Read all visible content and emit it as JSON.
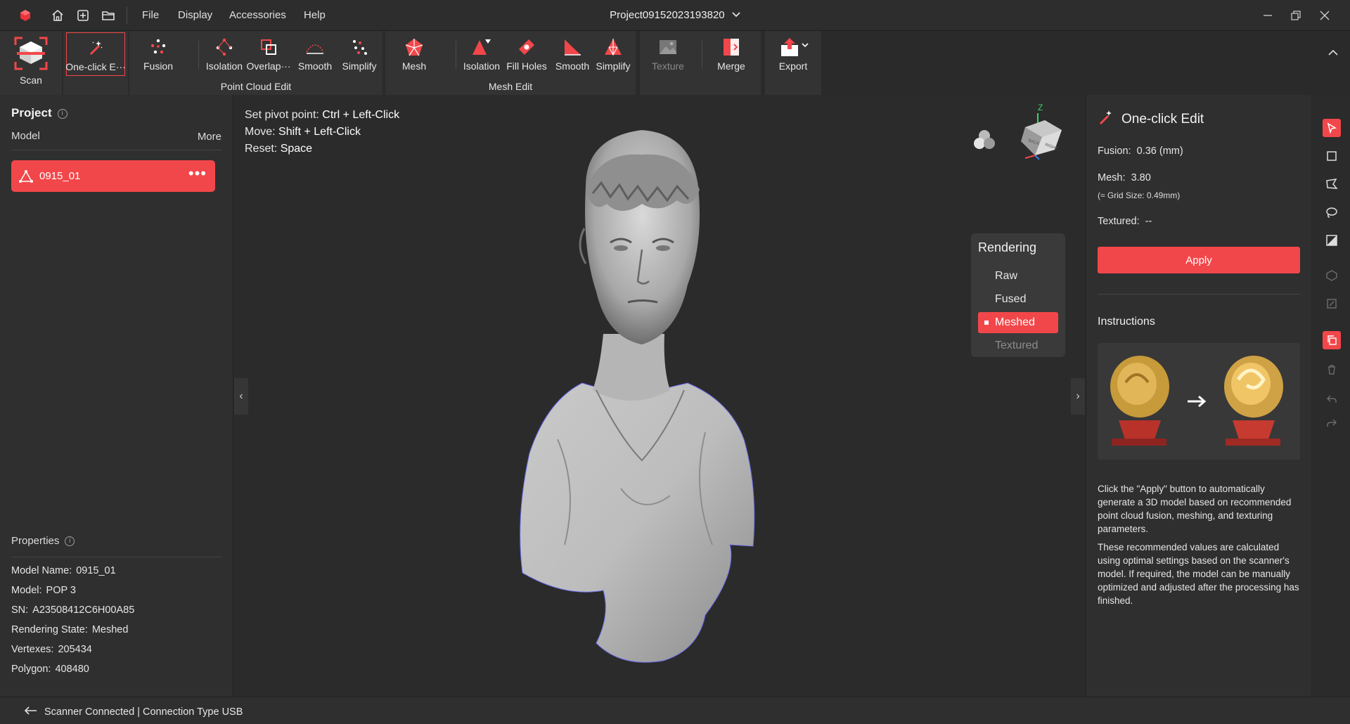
{
  "titlebar": {
    "menus": [
      "File",
      "Display",
      "Accessories",
      "Help"
    ],
    "project_title": "Project09152023193820"
  },
  "ribbon": {
    "scan_label": "Scan",
    "one_click_label": "One-click E···",
    "fusion_label": "Fusion",
    "pc_isolation_label": "Isolation",
    "pc_overlap_label": "Overlap···",
    "pc_smooth_label": "Smooth",
    "pc_simplify_label": "Simplify",
    "point_cloud_group": "Point Cloud Edit",
    "mesh_label": "Mesh",
    "mesh_isolation_label": "Isolation",
    "fill_holes_label": "Fill Holes",
    "mesh_smooth_label": "Smooth",
    "mesh_simplify_label": "Simplify",
    "mesh_group": "Mesh Edit",
    "texture_label": "Texture",
    "merge_label": "Merge",
    "export_label": "Export"
  },
  "left": {
    "project_title": "Project",
    "model_header": "Model",
    "more": "More",
    "model_name": "0915_01",
    "properties_title": "Properties",
    "props": [
      {
        "k": "Model Name:",
        "v": "0915_01"
      },
      {
        "k": "Model:",
        "v": "POP 3"
      },
      {
        "k": "SN:",
        "v": "A23508412C6H00A85"
      },
      {
        "k": "Rendering State:",
        "v": "Meshed"
      },
      {
        "k": "Vertexes:",
        "v": "205434"
      },
      {
        "k": "Polygon:",
        "v": "408480"
      }
    ]
  },
  "viewport": {
    "hints": [
      {
        "k": "Set pivot point:",
        "v": "Ctrl + Left-Click"
      },
      {
        "k": "Move:",
        "v": "Shift + Left-Click"
      },
      {
        "k": "Reset:",
        "v": "Space"
      }
    ],
    "viewcube_z": "Z",
    "viewcube_face1": "BACK",
    "viewcube_face2": "RIGHT",
    "rendering": {
      "title": "Rendering",
      "options": [
        "Raw",
        "Fused",
        "Meshed",
        "Textured"
      ],
      "selected": "Meshed"
    }
  },
  "right": {
    "title": "One-click Edit",
    "fusion_key": "Fusion:",
    "fusion_val": "0.36 (mm)",
    "mesh_key": "Mesh:",
    "mesh_val": "3.80",
    "mesh_sub": "(≈ Grid Size: 0.49mm)",
    "textured_key": "Textured:",
    "textured_val": "--",
    "apply": "Apply",
    "instructions_title": "Instructions",
    "instr_p1": "Click the \"Apply\" button to automatically generate a 3D model based on recommended point cloud fusion, meshing, and texturing parameters.",
    "instr_p2": "These recommended values are calculated using optimal settings based on the scanner's model. If required, the model can be manually optimized and adjusted after the processing has finished."
  },
  "status": {
    "text": "Scanner Connected | Connection Type USB"
  },
  "colors": {
    "accent": "#f2474a",
    "panel": "#2f2f2f",
    "viewport": "#2b2b2b"
  }
}
